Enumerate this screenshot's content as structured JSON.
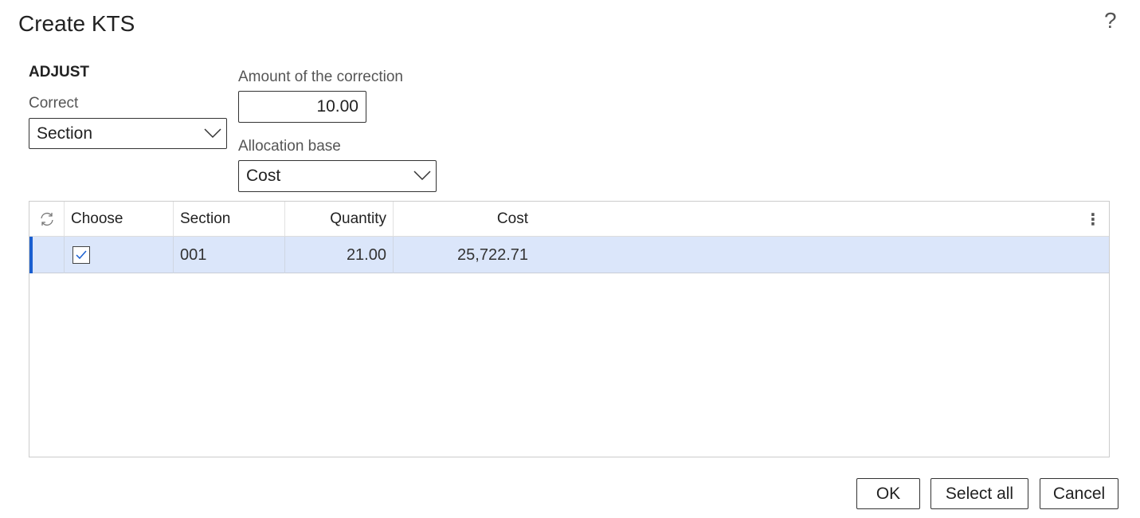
{
  "dialog": {
    "title": "Create KTS",
    "help_icon": "?"
  },
  "adjust": {
    "heading": "ADJUST",
    "correct_label": "Correct",
    "correct_value": "Section",
    "amount_label": "Amount of the correction",
    "amount_value": "10.00",
    "allocation_label": "Allocation base",
    "allocation_value": "Cost"
  },
  "grid": {
    "columns": [
      "Choose",
      "Section",
      "Quantity",
      "Cost"
    ],
    "rows": [
      {
        "choose": true,
        "section": "001",
        "quantity": "21.00",
        "cost": "25,722.71"
      }
    ]
  },
  "buttons": {
    "ok": "OK",
    "select_all": "Select all",
    "cancel": "Cancel"
  },
  "colors": {
    "accent": "#1a5fd0",
    "selected_row": "#dbe6fa"
  }
}
